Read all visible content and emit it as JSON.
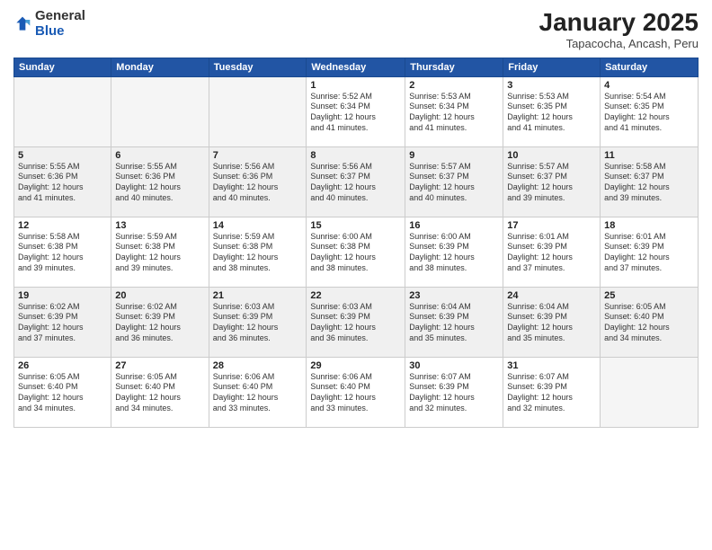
{
  "logo": {
    "general": "General",
    "blue": "Blue"
  },
  "title": "January 2025",
  "subtitle": "Tapacocha, Ancash, Peru",
  "weekdays": [
    "Sunday",
    "Monday",
    "Tuesday",
    "Wednesday",
    "Thursday",
    "Friday",
    "Saturday"
  ],
  "weeks": [
    [
      {
        "day": "",
        "info": ""
      },
      {
        "day": "",
        "info": ""
      },
      {
        "day": "",
        "info": ""
      },
      {
        "day": "1",
        "info": "Sunrise: 5:52 AM\nSunset: 6:34 PM\nDaylight: 12 hours\nand 41 minutes."
      },
      {
        "day": "2",
        "info": "Sunrise: 5:53 AM\nSunset: 6:34 PM\nDaylight: 12 hours\nand 41 minutes."
      },
      {
        "day": "3",
        "info": "Sunrise: 5:53 AM\nSunset: 6:35 PM\nDaylight: 12 hours\nand 41 minutes."
      },
      {
        "day": "4",
        "info": "Sunrise: 5:54 AM\nSunset: 6:35 PM\nDaylight: 12 hours\nand 41 minutes."
      }
    ],
    [
      {
        "day": "5",
        "info": "Sunrise: 5:55 AM\nSunset: 6:36 PM\nDaylight: 12 hours\nand 41 minutes."
      },
      {
        "day": "6",
        "info": "Sunrise: 5:55 AM\nSunset: 6:36 PM\nDaylight: 12 hours\nand 40 minutes."
      },
      {
        "day": "7",
        "info": "Sunrise: 5:56 AM\nSunset: 6:36 PM\nDaylight: 12 hours\nand 40 minutes."
      },
      {
        "day": "8",
        "info": "Sunrise: 5:56 AM\nSunset: 6:37 PM\nDaylight: 12 hours\nand 40 minutes."
      },
      {
        "day": "9",
        "info": "Sunrise: 5:57 AM\nSunset: 6:37 PM\nDaylight: 12 hours\nand 40 minutes."
      },
      {
        "day": "10",
        "info": "Sunrise: 5:57 AM\nSunset: 6:37 PM\nDaylight: 12 hours\nand 39 minutes."
      },
      {
        "day": "11",
        "info": "Sunrise: 5:58 AM\nSunset: 6:37 PM\nDaylight: 12 hours\nand 39 minutes."
      }
    ],
    [
      {
        "day": "12",
        "info": "Sunrise: 5:58 AM\nSunset: 6:38 PM\nDaylight: 12 hours\nand 39 minutes."
      },
      {
        "day": "13",
        "info": "Sunrise: 5:59 AM\nSunset: 6:38 PM\nDaylight: 12 hours\nand 39 minutes."
      },
      {
        "day": "14",
        "info": "Sunrise: 5:59 AM\nSunset: 6:38 PM\nDaylight: 12 hours\nand 38 minutes."
      },
      {
        "day": "15",
        "info": "Sunrise: 6:00 AM\nSunset: 6:38 PM\nDaylight: 12 hours\nand 38 minutes."
      },
      {
        "day": "16",
        "info": "Sunrise: 6:00 AM\nSunset: 6:39 PM\nDaylight: 12 hours\nand 38 minutes."
      },
      {
        "day": "17",
        "info": "Sunrise: 6:01 AM\nSunset: 6:39 PM\nDaylight: 12 hours\nand 37 minutes."
      },
      {
        "day": "18",
        "info": "Sunrise: 6:01 AM\nSunset: 6:39 PM\nDaylight: 12 hours\nand 37 minutes."
      }
    ],
    [
      {
        "day": "19",
        "info": "Sunrise: 6:02 AM\nSunset: 6:39 PM\nDaylight: 12 hours\nand 37 minutes."
      },
      {
        "day": "20",
        "info": "Sunrise: 6:02 AM\nSunset: 6:39 PM\nDaylight: 12 hours\nand 36 minutes."
      },
      {
        "day": "21",
        "info": "Sunrise: 6:03 AM\nSunset: 6:39 PM\nDaylight: 12 hours\nand 36 minutes."
      },
      {
        "day": "22",
        "info": "Sunrise: 6:03 AM\nSunset: 6:39 PM\nDaylight: 12 hours\nand 36 minutes."
      },
      {
        "day": "23",
        "info": "Sunrise: 6:04 AM\nSunset: 6:39 PM\nDaylight: 12 hours\nand 35 minutes."
      },
      {
        "day": "24",
        "info": "Sunrise: 6:04 AM\nSunset: 6:39 PM\nDaylight: 12 hours\nand 35 minutes."
      },
      {
        "day": "25",
        "info": "Sunrise: 6:05 AM\nSunset: 6:40 PM\nDaylight: 12 hours\nand 34 minutes."
      }
    ],
    [
      {
        "day": "26",
        "info": "Sunrise: 6:05 AM\nSunset: 6:40 PM\nDaylight: 12 hours\nand 34 minutes."
      },
      {
        "day": "27",
        "info": "Sunrise: 6:05 AM\nSunset: 6:40 PM\nDaylight: 12 hours\nand 34 minutes."
      },
      {
        "day": "28",
        "info": "Sunrise: 6:06 AM\nSunset: 6:40 PM\nDaylight: 12 hours\nand 33 minutes."
      },
      {
        "day": "29",
        "info": "Sunrise: 6:06 AM\nSunset: 6:40 PM\nDaylight: 12 hours\nand 33 minutes."
      },
      {
        "day": "30",
        "info": "Sunrise: 6:07 AM\nSunset: 6:39 PM\nDaylight: 12 hours\nand 32 minutes."
      },
      {
        "day": "31",
        "info": "Sunrise: 6:07 AM\nSunset: 6:39 PM\nDaylight: 12 hours\nand 32 minutes."
      },
      {
        "day": "",
        "info": ""
      }
    ]
  ]
}
